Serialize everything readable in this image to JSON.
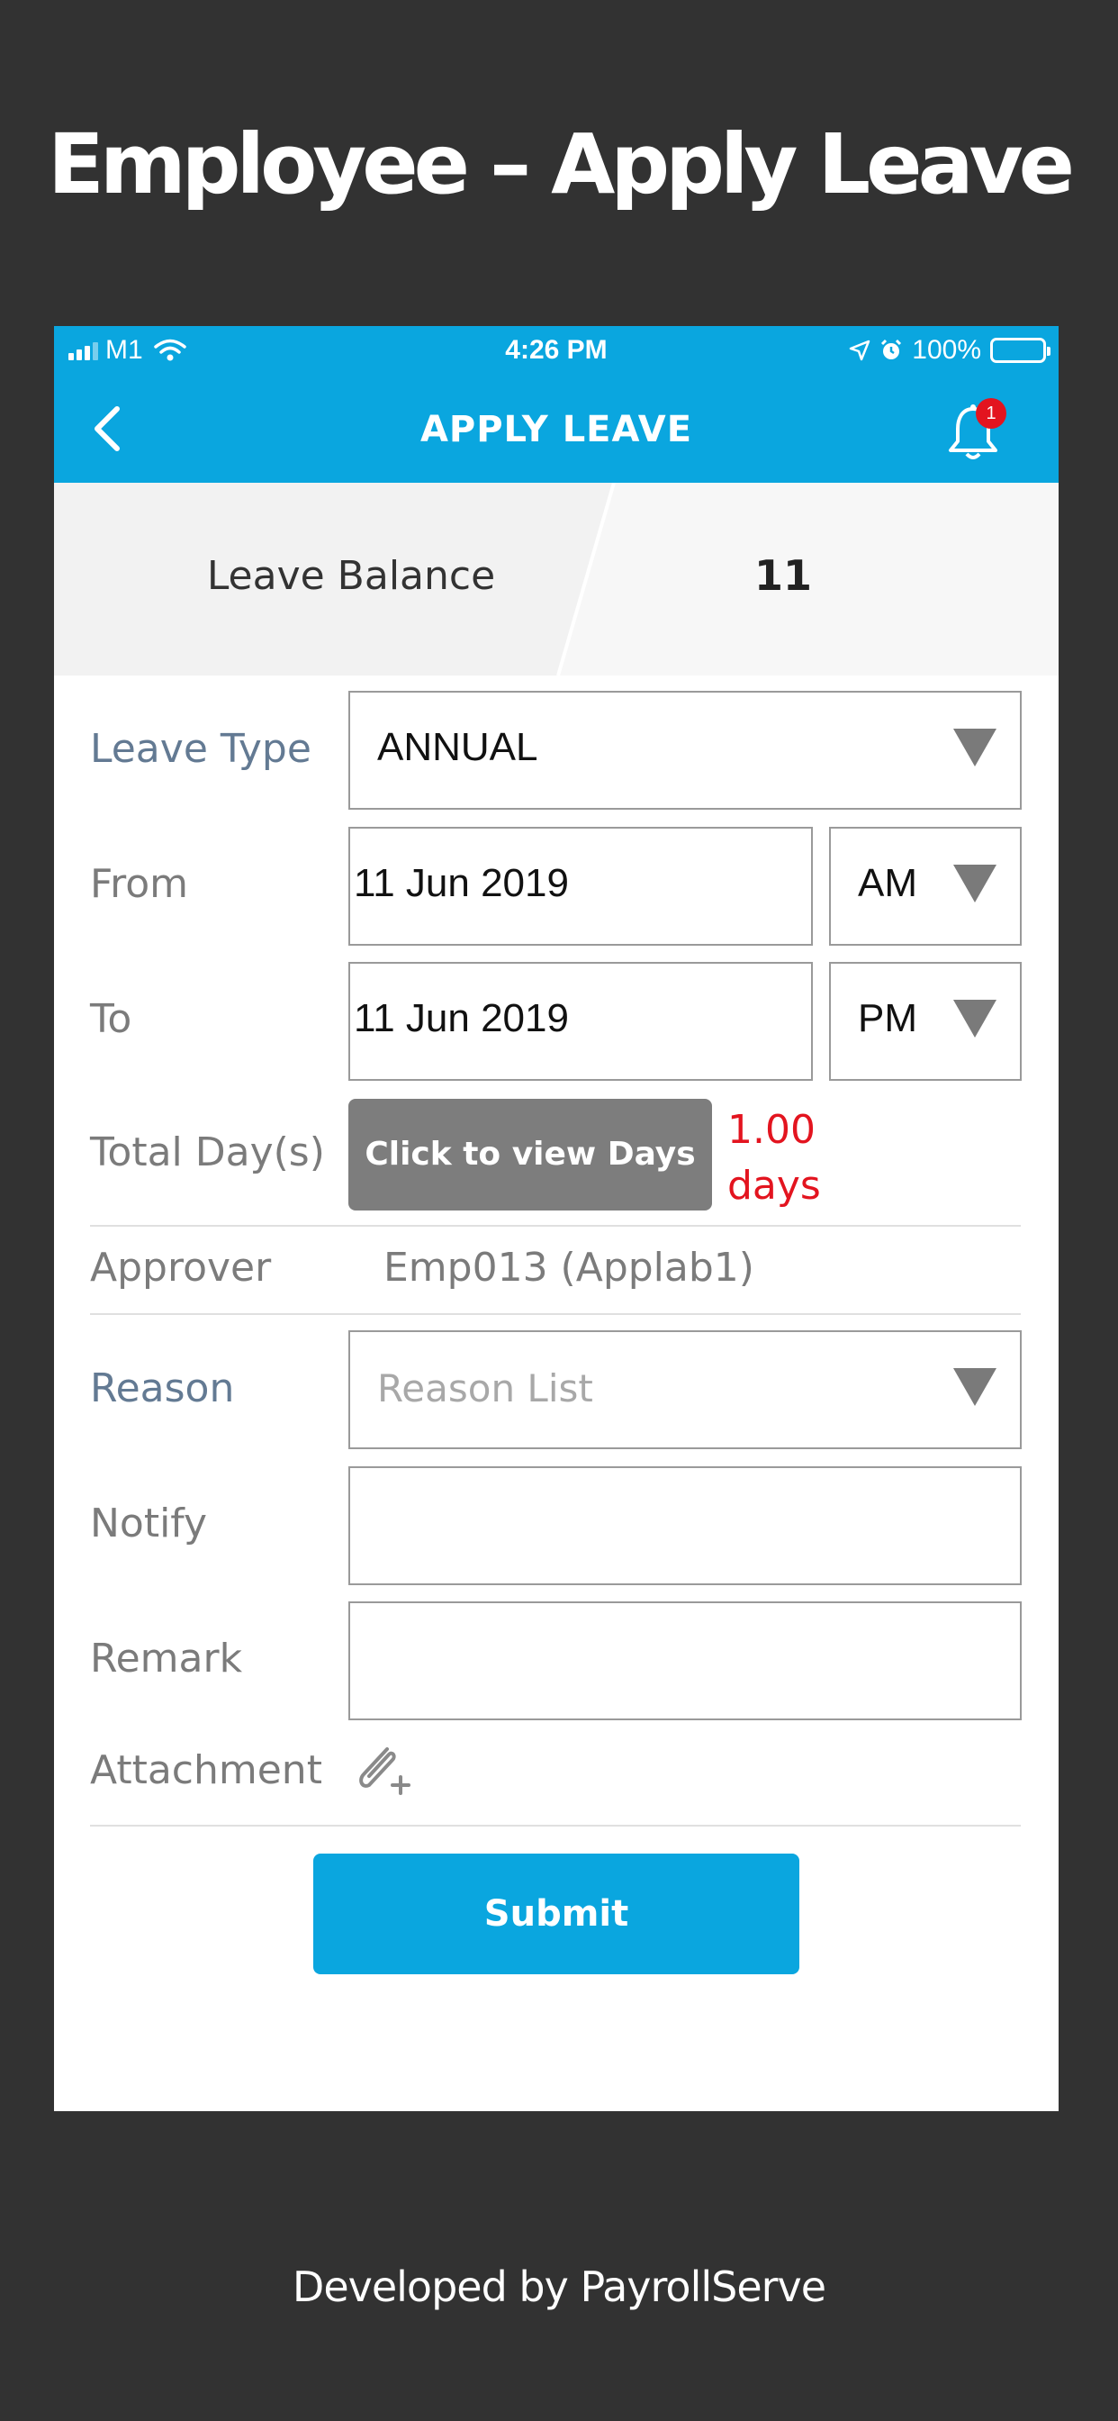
{
  "promo": {
    "title": "Employee – Apply Leave",
    "footer": "Developed by PayrollServe"
  },
  "status_bar": {
    "carrier": "M1",
    "time": "4:26 PM",
    "battery": "100%"
  },
  "header": {
    "title": "APPLY LEAVE",
    "notification_count": "1",
    "back_icon": "chevron-left-icon",
    "bell_icon": "bell-icon"
  },
  "balance": {
    "label": "Leave Balance",
    "value": "11"
  },
  "form": {
    "leave_type": {
      "label": "Leave Type",
      "value": "ANNUAL"
    },
    "from": {
      "label": "From",
      "date": "11 Jun 2019",
      "session": "AM"
    },
    "to": {
      "label": "To",
      "date": "11 Jun 2019",
      "session": "PM"
    },
    "total_days": {
      "label": "Total Day(s)",
      "button": "Click to view Days",
      "value": "1.00",
      "unit": "days"
    },
    "approver": {
      "label": "Approver",
      "value": "Emp013 (Applab1)"
    },
    "reason": {
      "label": "Reason",
      "placeholder": "Reason List"
    },
    "notify": {
      "label": "Notify",
      "value": ""
    },
    "remark": {
      "label": "Remark",
      "value": ""
    },
    "attachment": {
      "label": "Attachment",
      "icon": "paperclip-add-icon"
    },
    "submit": "Submit"
  },
  "colors": {
    "accent": "#0aa6df",
    "error": "#e3141f",
    "background": "#323232"
  }
}
